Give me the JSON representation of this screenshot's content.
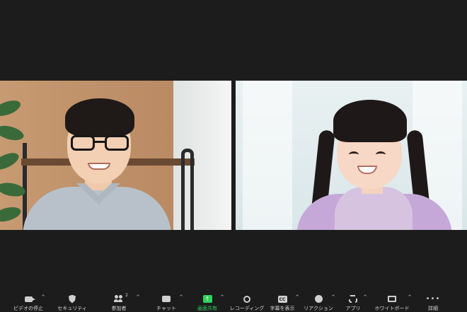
{
  "participants": [
    {
      "name": "",
      "role": "adult-man-with-glasses"
    },
    {
      "name": "",
      "role": "girl-with-pigtails"
    }
  ],
  "toolbar": {
    "items": [
      {
        "id": "video",
        "icon": "video-camera-icon",
        "label": "ビデオの停止",
        "chevron": "^"
      },
      {
        "id": "security",
        "icon": "shield-icon",
        "label": "セキュリティ",
        "chevron": ""
      },
      {
        "id": "participants",
        "icon": "participants-icon",
        "label": "参加者",
        "count": "2",
        "chevron": "^"
      },
      {
        "id": "chat",
        "icon": "chat-icon",
        "label": "チャット",
        "chevron": "^"
      },
      {
        "id": "share",
        "icon": "share-screen-icon",
        "label": "画面共有",
        "chevron": "^"
      },
      {
        "id": "record",
        "icon": "record-icon",
        "label": "レコーディング",
        "chevron": ""
      },
      {
        "id": "captions",
        "icon": "closed-caption-icon",
        "icon_text": "CC",
        "label": "字幕を表示",
        "chevron": "^"
      },
      {
        "id": "reactions",
        "icon": "reaction-icon",
        "label": "リアクション",
        "chevron": "^"
      },
      {
        "id": "apps",
        "icon": "apps-icon",
        "label": "アプリ",
        "chevron": "^"
      },
      {
        "id": "whiteboard",
        "icon": "whiteboard-icon",
        "label": "ホワイトボード",
        "chevron": "^"
      },
      {
        "id": "more",
        "icon": "more-dots-icon",
        "icon_text": "•••",
        "label": "詳細",
        "chevron": ""
      }
    ]
  },
  "colors": {
    "background": "#1c1c1c",
    "share_accent": "#2fd45a",
    "toolbar_text": "#d8d8d8"
  }
}
